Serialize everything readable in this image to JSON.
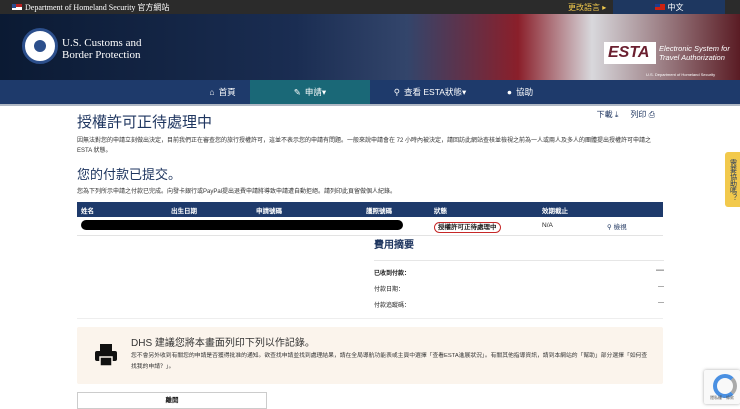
{
  "topbar": {
    "dhs_label": "Department of Homeland Security 官方網站",
    "change_language": "更改語言 ▸",
    "language": "中文"
  },
  "header": {
    "agency_line1": "U.S. Customs and",
    "agency_line2": "Border Protection",
    "esta_logo": "ESTA",
    "esta_line1": "Electronic System for",
    "esta_line2": "Travel Authorization",
    "esta_sub": "U.S. Department of Homeland Security"
  },
  "nav": {
    "items": [
      {
        "label": "首頁"
      },
      {
        "label": "申請▾"
      },
      {
        "label": "查看 ESTA狀態▾"
      },
      {
        "label": "協助"
      }
    ]
  },
  "actions": {
    "download": "下載",
    "print": "列印"
  },
  "main": {
    "title": "授權許可正待處理中",
    "description": "因無法對您的申請立刻做出決定，目前我們正在審查您的旅行授權許可，這並不表示您的申請有問題。一般來說申請會在 72 小時內被決定，請回訪此網站查核並檢視之前為一人或兩人及多人的團體提出授權許可申請之 ESTA 狀態。",
    "payment_title": "您的付款已提交。",
    "payment_text": "您為下列所示申請之付款已完成。向發卡銀行或PayPal提出退費申請將導致申請遭自動拒絕。請列印此頁留做個人紀錄。"
  },
  "table": {
    "headers": [
      "姓名",
      "出生日期",
      "申請號碼",
      "護照號碼",
      "狀態",
      "效期截止",
      ""
    ],
    "rows": [
      {
        "status": "授權許可正待處理中",
        "expiry": "N/A",
        "action": "檢視"
      }
    ]
  },
  "fees": {
    "title": "費用摘要",
    "rows": [
      {
        "label": "已收到付款：",
        "value": "----"
      },
      {
        "label": "付款日期：",
        "value": "---"
      },
      {
        "label": "付款追蹤碼：",
        "value": "---"
      }
    ]
  },
  "notice": {
    "title": "DHS 建議您將本畫面列印下列以作記錄。",
    "text": "您不會另外收到有關您的申請是否獲得批准的通知。欲查找申請並找到處理結果，請在全局導航功能表或主頁中選擇「查看ESTA進展狀況」。有關其他指導資訊，請到本網站的「幫助」部分選擇「如何查找我的申請？」。"
  },
  "leave_button": "離開",
  "side_tab": "需要協助嗎？",
  "recaptcha": "隱私權・條款"
}
